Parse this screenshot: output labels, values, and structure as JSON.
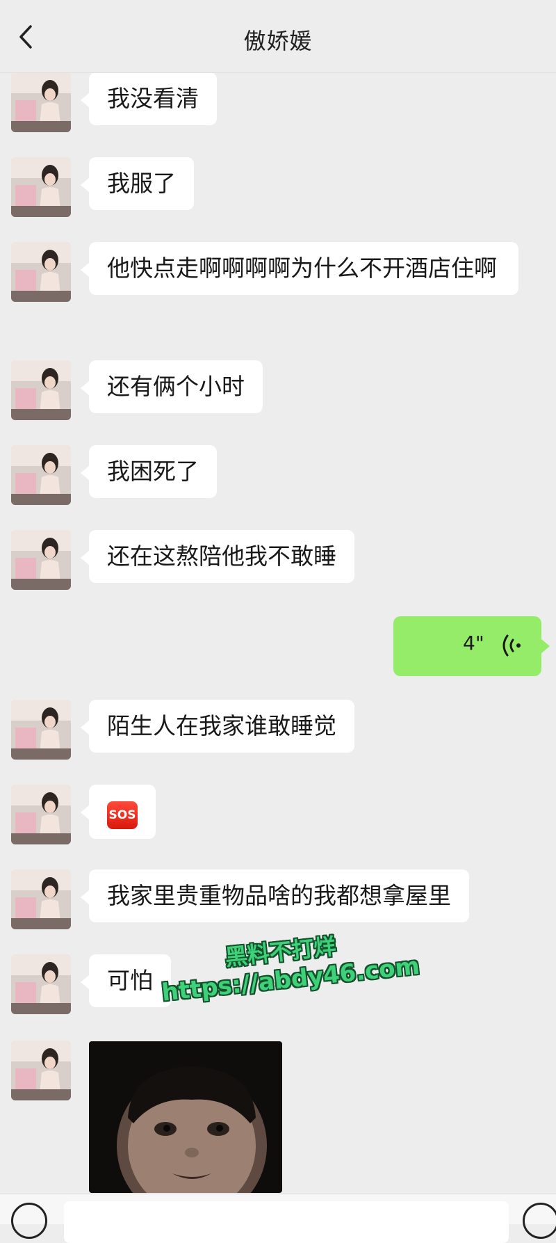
{
  "header": {
    "back_icon": "chevron-left-icon",
    "title": "傲娇媛"
  },
  "messages": [
    {
      "side": "left",
      "type": "text",
      "text": "我没看清"
    },
    {
      "side": "left",
      "type": "text",
      "text": "我服了"
    },
    {
      "side": "left",
      "type": "text",
      "text": "他快点走啊啊啊啊为什么不开酒店住啊"
    },
    {
      "side": "left",
      "type": "text",
      "text": "还有俩个小时"
    },
    {
      "side": "left",
      "type": "text",
      "text": "我困死了"
    },
    {
      "side": "left",
      "type": "text",
      "text": "还在这熬陪他我不敢睡"
    },
    {
      "side": "right",
      "type": "voice",
      "duration": "4\"",
      "icon": "voice-wave-icon"
    },
    {
      "side": "left",
      "type": "text",
      "text": "陌生人在我家谁敢睡觉"
    },
    {
      "side": "left",
      "type": "emoji",
      "text": "SOS",
      "icon": "sos-emoji-icon"
    },
    {
      "side": "left",
      "type": "text",
      "text": "我家里贵重物品啥的我都想拿屋里"
    },
    {
      "side": "left",
      "type": "text",
      "text": "可怕"
    },
    {
      "side": "left",
      "type": "image",
      "icon": "child-face-sticker"
    }
  ],
  "watermark": {
    "line1": "黑料不打烊",
    "line2": "https://abdy46.com"
  },
  "colors": {
    "background": "#ededed",
    "bubble_incoming": "#ffffff",
    "bubble_outgoing": "#95ec69",
    "watermark": "#3fd17a"
  },
  "input": {
    "voice_toggle_icon": "voice-mode-icon",
    "plus_icon": "plus-circle-icon"
  }
}
